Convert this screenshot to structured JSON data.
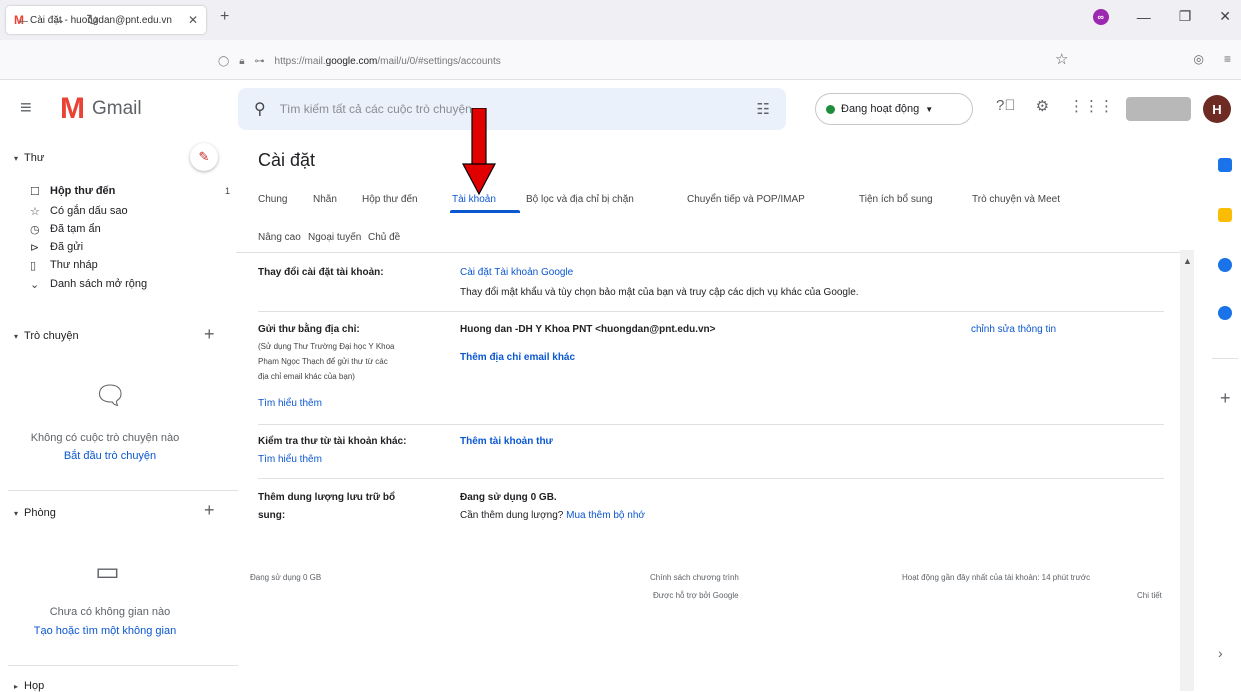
{
  "browser": {
    "tab_title": "Cài đặt - huongdan@pnt.edu.vn",
    "tab_icon": "M",
    "url_prefix": "https://mail.",
    "url_host": "google.com",
    "url_path": "/mail/u/0/#settings/accounts"
  },
  "gmail": {
    "product": "Gmail",
    "search_placeholder": "Tìm kiếm tất cả các cuộc trò chuyện",
    "status": "Đang hoạt động",
    "avatar_letter": "H"
  },
  "sidebar": {
    "mail_header": "Thư",
    "items": [
      {
        "label": "Hộp thư đến",
        "icon": "inbox-icon",
        "count": "1"
      },
      {
        "label": "Có gắn dấu sao",
        "icon": "star-icon",
        "count": ""
      },
      {
        "label": "Đã tạm ẩn",
        "icon": "clock-icon",
        "count": ""
      },
      {
        "label": "Đã gửi",
        "icon": "send-icon",
        "count": ""
      },
      {
        "label": "Thư nháp",
        "icon": "draft-icon",
        "count": ""
      },
      {
        "label": "Danh sách mở rộng",
        "icon": "chevron-down-icon",
        "count": ""
      }
    ],
    "chat_header": "Trò chuyện",
    "chat_empty": "Không có cuộc trò chuyện nào",
    "chat_start": "Bắt đầu trò chuyện",
    "spaces_header": "Phòng",
    "spaces_empty": "Chưa có không gian nào",
    "spaces_link": "Tạo hoặc tìm một không gian",
    "meet_header": "Họp"
  },
  "settings": {
    "title": "Cài đặt",
    "tabs": [
      "Chung",
      "Nhãn",
      "Hộp thư đến",
      "Tài khoản",
      "Bộ lọc và địa chỉ bị chặn",
      "Chuyển tiếp và POP/IMAP",
      "Tiện ích bổ sung",
      "Trò chuyện và Meet"
    ],
    "tabs_row2": [
      "Nâng cao",
      "Ngoại tuyến",
      "Chủ đề"
    ],
    "active_tab": "Tài khoản",
    "rows": {
      "change_label": "Thay đổi cài đặt tài khoản:",
      "google_account_link": "Cài đặt Tài khoản Google",
      "google_account_desc": "Thay đổi mật khẩu và tùy chọn bảo mật của bạn và truy cập các dịch vụ khác của Google.",
      "send_as_label": "Gửi thư bằng địa chỉ:",
      "send_as_note": [
        "(Sử dụng Thư Trường Đại học Y Khoa",
        "Phạm Ngọc Thạch để gửi thư từ các",
        "địa chỉ email khác của bạn)"
      ],
      "learn_more": "Tìm hiểu thêm",
      "send_as_value": "Huong dan -DH Y Khoa PNT <huongdan@pnt.edu.vn>",
      "edit_info": "chỉnh sửa thông tin",
      "add_email": "Thêm địa chỉ email khác",
      "check_mail_label": "Kiểm tra thư từ tài khoản khác:",
      "add_mail_account": "Thêm tài khoản thư",
      "storage_label_1": "Thêm dung lượng lưu trữ bổ",
      "storage_label_2": "sung:",
      "storage_used": "Đang sử dụng 0 GB.",
      "storage_need": "Cần thêm dung lượng?",
      "buy_storage": "Mua thêm bộ nhớ"
    },
    "footer": {
      "usage": "Đang sử dụng 0 GB",
      "policy": "Chính sách chương trình",
      "powered": "Được hỗ trợ bởi Google",
      "activity": "Hoạt động gần đây nhất của tài khoản: 14 phút trước",
      "details": "Chi tiết"
    }
  },
  "colors": {
    "accent": "#0b57d0",
    "arrow": "#e00000"
  }
}
